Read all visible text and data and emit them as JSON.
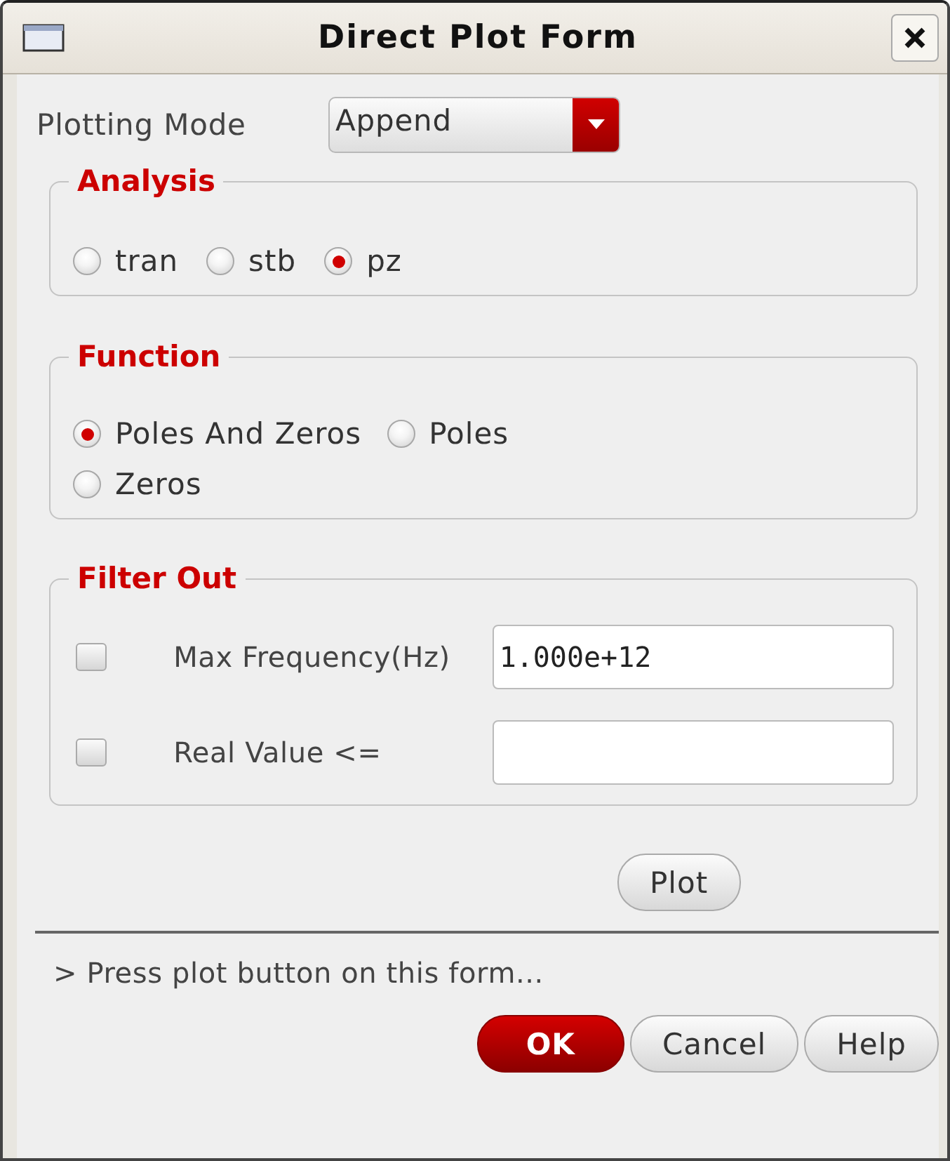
{
  "window": {
    "title": "Direct Plot Form"
  },
  "plotting_mode": {
    "label": "Plotting Mode",
    "value": "Append"
  },
  "analysis": {
    "title": "Analysis",
    "options": [
      {
        "label": "tran",
        "selected": false
      },
      {
        "label": "stb",
        "selected": false
      },
      {
        "label": "pz",
        "selected": true
      }
    ]
  },
  "function": {
    "title": "Function",
    "options": [
      {
        "label": "Poles And Zeros",
        "selected": true
      },
      {
        "label": "Poles",
        "selected": false
      },
      {
        "label": "Zeros",
        "selected": false
      }
    ]
  },
  "filter_out": {
    "title": "Filter Out",
    "rows": [
      {
        "label": "Max Frequency(Hz)",
        "checked": false,
        "value": "1.000e+12"
      },
      {
        "label": "Real Value <=",
        "checked": false
      }
    ]
  },
  "plot_button": "Plot",
  "status": "> Press plot button on this form...",
  "buttons": [
    {
      "label": "OK",
      "kind": "default"
    },
    {
      "label": "Cancel",
      "kind": "normal"
    },
    {
      "label": "Help",
      "kind": "normal"
    }
  ]
}
